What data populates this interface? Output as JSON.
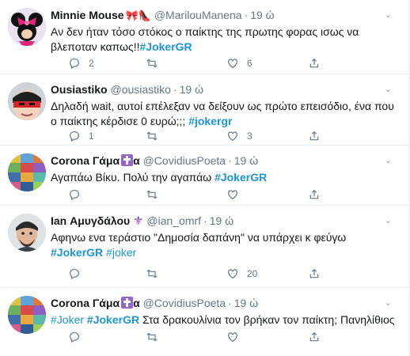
{
  "tweets": [
    {
      "name": "Minnie Mouse",
      "emoji": "🎀👠",
      "handle": "@MarilouManena",
      "time": "19 ώ",
      "text_before": "Αν δεν ήταν τόσο στόκος ο παίκτης της πρωτης φορας ισως να βλεποταν καπως!!",
      "tags": [
        "#JokerGR"
      ],
      "text_after": "",
      "replies": "2",
      "retweets": "",
      "likes": "6",
      "avatar": "minnie-mouse-avatar"
    },
    {
      "name": "Ousiastiko",
      "handle": "@ousiastiko",
      "time": "19 ώ",
      "text_before": "Δηλαδή wait, αυτοί επέλεξαν να δείξουν ως πρώτο επεισόδιο, ένα που ο παίκτης κέρδισε 0 ευρώ;;;",
      "tags": [
        "#jokergr"
      ],
      "text_after": "",
      "replies": "1",
      "retweets": "",
      "likes": "3",
      "avatar": "masked-face-avatar"
    },
    {
      "name": "Corona Γάμα",
      "name_suffix": "α",
      "handle": "@CovidiusPoeta",
      "time": "19 ώ",
      "text_before": "Αγαπάω Βίκυ. Πολύ την αγαπάω",
      "tags": [
        "#JokerGR"
      ],
      "text_after": "",
      "replies": "",
      "retweets": "",
      "likes": "",
      "avatar": "colorful-pattern-avatar"
    },
    {
      "name": "Ian Αμυγδάλου",
      "handle": "@ian_omrf",
      "time": "19 ώ",
      "text_before": "Αφηνω ενα τεράστιο \"Δημοσία δαπάνη\" να υπάρχει κ φεύγω",
      "tags": [
        "#JokerGR",
        "#joker"
      ],
      "text_after": "",
      "replies": "",
      "retweets": "",
      "likes": "20",
      "avatar": "man-portrait-avatar"
    },
    {
      "name": "Corona Γάμα",
      "name_suffix": "α",
      "handle": "@CovidiusPoeta",
      "time": "19 ώ",
      "text_before": "",
      "tags": [
        "#Joker",
        "#JokerGR"
      ],
      "text_after": "Στα δρακουλίνια τον βρήκαν τον παίκτη; Πανηλίθιος",
      "replies": "",
      "retweets": "",
      "likes": "",
      "avatar": "colorful-pattern-avatar"
    }
  ],
  "icons": {
    "reply": "reply-icon",
    "retweet": "retweet-icon",
    "like": "heart-icon",
    "share": "share-icon",
    "more": "chevron-down-icon"
  },
  "colors": {
    "link": "#1b95e0",
    "secondary": "#657786",
    "border": "#e6ecf0"
  }
}
